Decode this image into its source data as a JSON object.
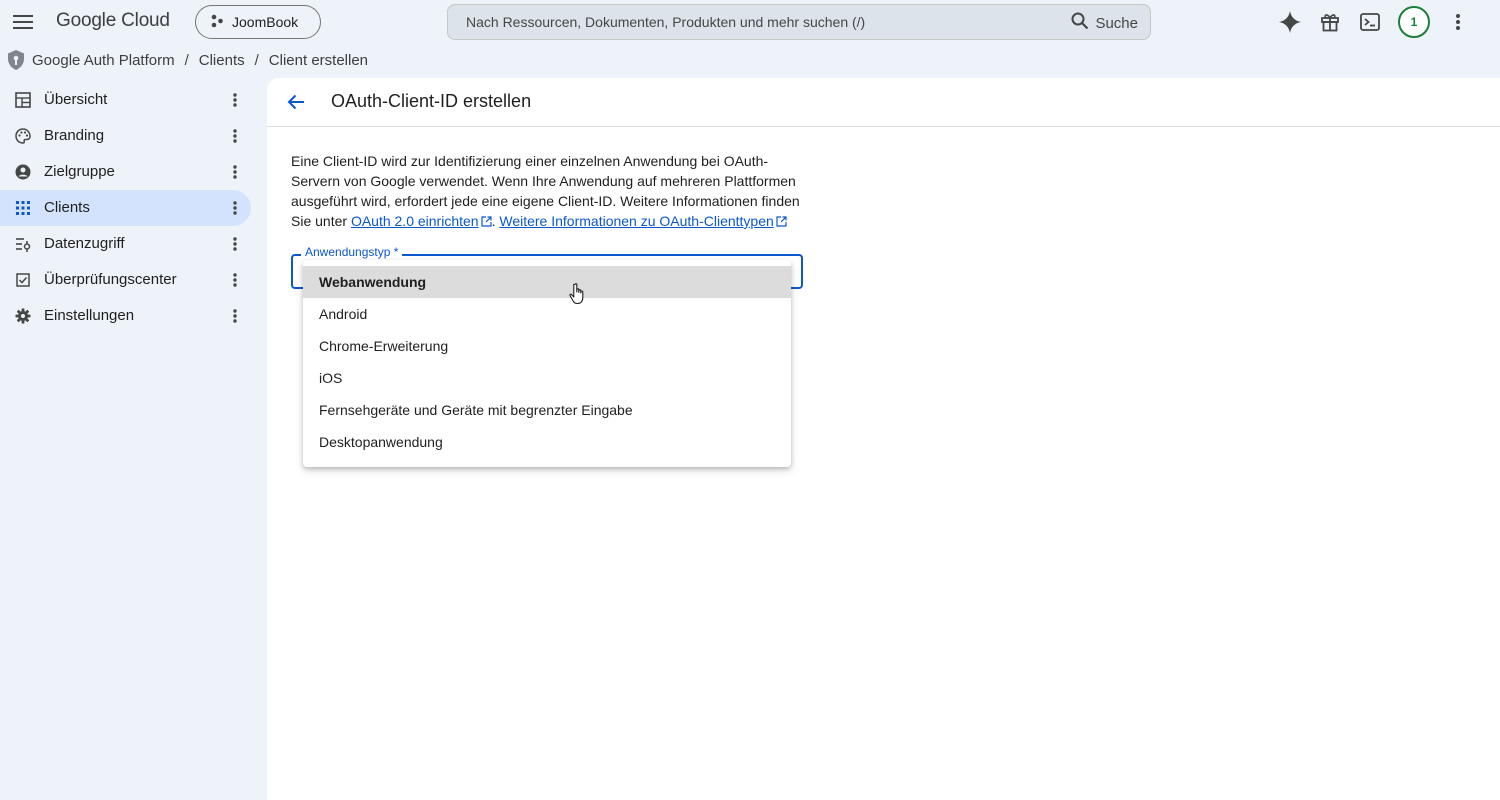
{
  "topbar": {
    "logo": "Google Cloud",
    "project": "JoomBook",
    "search_placeholder": "Nach Ressourcen, Dokumenten, Produkten und mehr suchen (/)",
    "search_button": "Suche",
    "avatar_text": "1"
  },
  "breadcrumb": {
    "items": [
      "Google Auth Platform",
      "Clients",
      "Client erstellen"
    ]
  },
  "sidebar": {
    "items": [
      {
        "label": "Übersicht",
        "icon": "dashboard-icon"
      },
      {
        "label": "Branding",
        "icon": "palette-icon"
      },
      {
        "label": "Zielgruppe",
        "icon": "account-circle-icon"
      },
      {
        "label": "Clients",
        "icon": "apps-grid-icon",
        "active": true
      },
      {
        "label": "Datenzugriff",
        "icon": "tune-list-icon"
      },
      {
        "label": "Überprüfungscenter",
        "icon": "checkbox-icon"
      },
      {
        "label": "Einstellungen",
        "icon": "gear-icon"
      }
    ]
  },
  "main": {
    "title": "OAuth-Client-ID erstellen",
    "desc_text": "Eine Client-ID wird zur Identifizierung einer einzelnen Anwendung bei OAuth-Servern von Google verwendet. Wenn Ihre Anwendung auf mehreren Plattformen ausgeführt wird, erfordert jede eine eigene Client-ID. Weitere Informationen finden Sie unter ",
    "link1": "OAuth 2.0 einrichten",
    "link_separator": ".",
    "link2": "Weitere Informationen zu OAuth-Clienttypen",
    "field_label": "Anwendungstyp *",
    "options": [
      "Webanwendung",
      "Android",
      "Chrome-Erweiterung",
      "iOS",
      "Fernsehgeräte und Geräte mit begrenzter Eingabe",
      "Desktopanwendung"
    ],
    "hovered_option": "Webanwendung"
  },
  "colors": {
    "accent": "#0b57d0",
    "active_nav": "#d3e3fd",
    "background": "#eef2f9",
    "avatar_ring": "#188038"
  }
}
